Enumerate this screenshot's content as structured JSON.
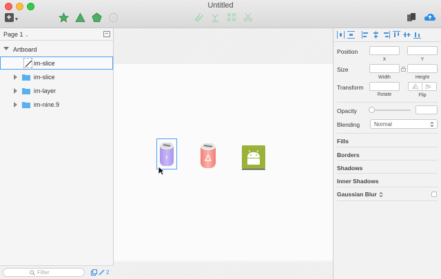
{
  "window": {
    "title": "Untitled"
  },
  "toolbar": {
    "insert_label": "+"
  },
  "layers": {
    "page_selector": "Page 1",
    "artboard_label": "Artboard",
    "items": [
      {
        "label": "im-slice",
        "kind": "slice",
        "selected": true
      },
      {
        "label": "im-slice",
        "kind": "folder"
      },
      {
        "label": "im-layer",
        "kind": "folder"
      },
      {
        "label": "im-nine.9",
        "kind": "folder"
      }
    ],
    "filter_placeholder": "Filter",
    "badge_count": "2"
  },
  "inspector": {
    "position_label": "Position",
    "x_label": "X",
    "y_label": "Y",
    "size_label": "Size",
    "width_label": "Width",
    "height_label": "Height",
    "transform_label": "Transform",
    "rotate_label": "Rotate",
    "flip_label": "Flip",
    "opacity_label": "Opacity",
    "blending_label": "Blending",
    "blending_value": "Normal",
    "sections": [
      "Fills",
      "Borders",
      "Shadows",
      "Inner Shadows",
      "Gaussian Blur"
    ]
  },
  "colors": {
    "selection": "#4a9ff5",
    "purple_icon": "#b7a3f0",
    "red_icon": "#f58b83",
    "android_green": "#9ab23a",
    "tool_green": "#3aa552"
  }
}
